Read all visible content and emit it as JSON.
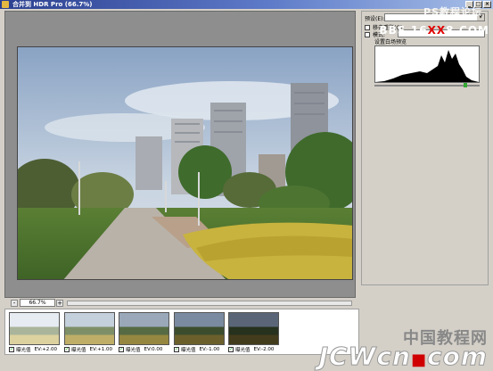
{
  "window": {
    "title": "合并到 HDR Pro (66.7%)"
  },
  "preview": {
    "zoom": "66.7%"
  },
  "side_panel": {
    "preset_label": "预设(E):",
    "preset_value": "",
    "remove_ghosts_label": "移去重影(G)",
    "mode_label": "模式:",
    "histogram_label": "设置白场预览"
  },
  "filmstrip": {
    "thumbnails": [
      {
        "label": "曝光值",
        "ev": "EV:+2.00",
        "checked": true
      },
      {
        "label": "曝光值",
        "ev": "EV:+1.00",
        "checked": true
      },
      {
        "label": "曝光值",
        "ev": "EV:0.00",
        "checked": true
      },
      {
        "label": "曝光值",
        "ev": "EV:-1.00",
        "checked": true
      },
      {
        "label": "曝光值",
        "ev": "EV:-2.00",
        "checked": true
      }
    ]
  },
  "watermarks": {
    "top": "PS教程论坛",
    "site_pre": "BBS.16",
    "site_x": "XX",
    "site_post": "8.COM",
    "cn": "中国教程网",
    "logo_pre": "JCWcn",
    "logo_dot": "■",
    "logo_post": "com"
  }
}
